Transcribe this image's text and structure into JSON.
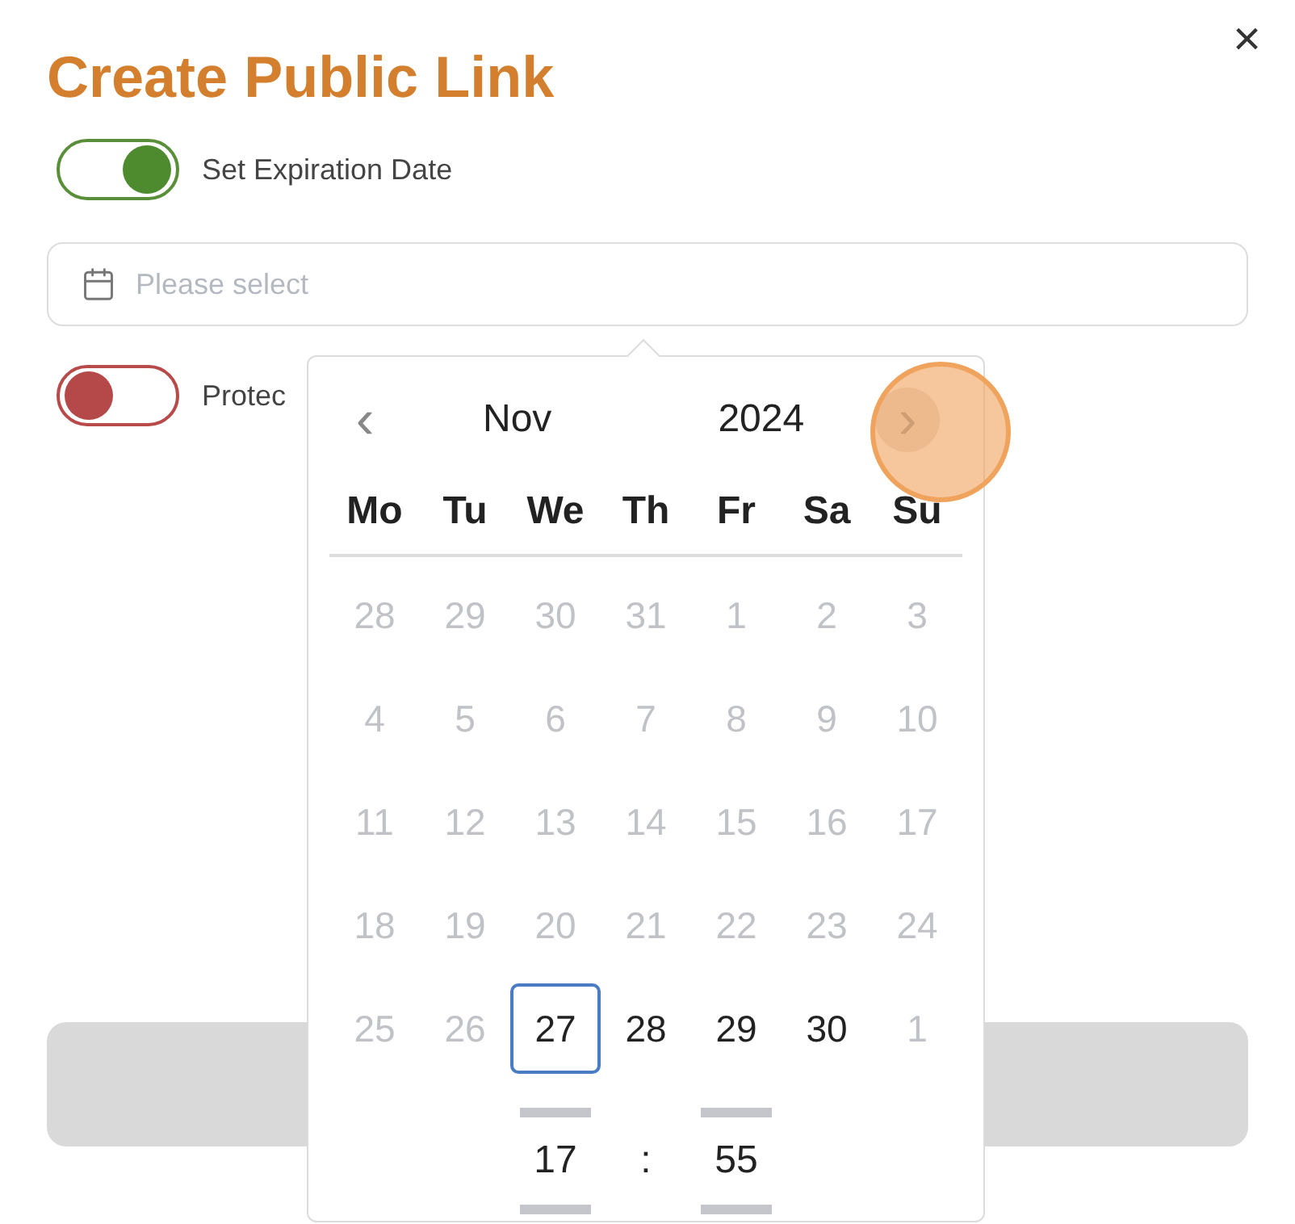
{
  "dialog": {
    "title": "Create Public Link",
    "close": "×"
  },
  "toggles": [
    {
      "label": "Set Expiration Date",
      "on": true
    },
    {
      "label": "Protec",
      "on": false
    }
  ],
  "date_field": {
    "placeholder": "Please select"
  },
  "calendar": {
    "prev": "‹",
    "next": "›",
    "month": "Nov",
    "year": "2024",
    "weekdays": [
      "Mo",
      "Tu",
      "We",
      "Th",
      "Fr",
      "Sa",
      "Su"
    ],
    "days": [
      {
        "label": "28",
        "disabled": true,
        "selected": false
      },
      {
        "label": "29",
        "disabled": true,
        "selected": false
      },
      {
        "label": "30",
        "disabled": true,
        "selected": false
      },
      {
        "label": "31",
        "disabled": true,
        "selected": false
      },
      {
        "label": "1",
        "disabled": true,
        "selected": false
      },
      {
        "label": "2",
        "disabled": true,
        "selected": false
      },
      {
        "label": "3",
        "disabled": true,
        "selected": false
      },
      {
        "label": "4",
        "disabled": true,
        "selected": false
      },
      {
        "label": "5",
        "disabled": true,
        "selected": false
      },
      {
        "label": "6",
        "disabled": true,
        "selected": false
      },
      {
        "label": "7",
        "disabled": true,
        "selected": false
      },
      {
        "label": "8",
        "disabled": true,
        "selected": false
      },
      {
        "label": "9",
        "disabled": true,
        "selected": false
      },
      {
        "label": "10",
        "disabled": true,
        "selected": false
      },
      {
        "label": "11",
        "disabled": true,
        "selected": false
      },
      {
        "label": "12",
        "disabled": true,
        "selected": false
      },
      {
        "label": "13",
        "disabled": true,
        "selected": false
      },
      {
        "label": "14",
        "disabled": true,
        "selected": false
      },
      {
        "label": "15",
        "disabled": true,
        "selected": false
      },
      {
        "label": "16",
        "disabled": true,
        "selected": false
      },
      {
        "label": "17",
        "disabled": true,
        "selected": false
      },
      {
        "label": "18",
        "disabled": true,
        "selected": false
      },
      {
        "label": "19",
        "disabled": true,
        "selected": false
      },
      {
        "label": "20",
        "disabled": true,
        "selected": false
      },
      {
        "label": "21",
        "disabled": true,
        "selected": false
      },
      {
        "label": "22",
        "disabled": true,
        "selected": false
      },
      {
        "label": "23",
        "disabled": true,
        "selected": false
      },
      {
        "label": "24",
        "disabled": true,
        "selected": false
      },
      {
        "label": "25",
        "disabled": true,
        "selected": false
      },
      {
        "label": "26",
        "disabled": true,
        "selected": false
      },
      {
        "label": "27",
        "disabled": false,
        "selected": true
      },
      {
        "label": "28",
        "disabled": false,
        "selected": false
      },
      {
        "label": "29",
        "disabled": false,
        "selected": false
      },
      {
        "label": "30",
        "disabled": false,
        "selected": false
      },
      {
        "label": "1",
        "disabled": true,
        "selected": false
      }
    ],
    "time": {
      "hour": "17",
      "separator": ":",
      "minute": "55"
    }
  }
}
